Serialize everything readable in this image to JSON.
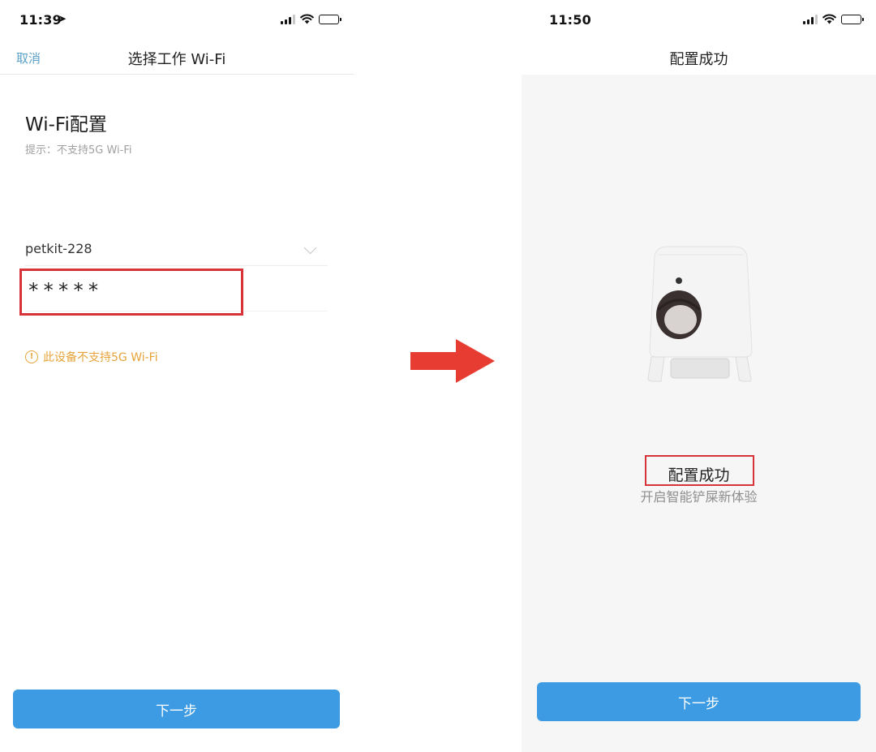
{
  "colors": {
    "accent_blue": "#3d9be3",
    "link_blue": "#5aa0c8",
    "warning_orange": "#e6a33a",
    "highlight_red": "#d9333a",
    "arrow_red": "#e63c32"
  },
  "left_screen": {
    "status": {
      "time": "11:39"
    },
    "nav": {
      "cancel_label": "取消",
      "title": "选择工作 Wi-Fi"
    },
    "section_title": "Wi-Fi配置",
    "hint": "提示：不支持5G Wi-Fi",
    "ssid_value": "petkit-228",
    "password_value": "*****",
    "warning_icon": "info-icon",
    "warning_text": "此设备不支持5G Wi-Fi",
    "next_label": "下一步"
  },
  "right_screen": {
    "status": {
      "time": "11:50"
    },
    "nav": {
      "title": "配置成功"
    },
    "success_title": "配置成功",
    "success_subtitle": "开启智能铲屎新体验",
    "next_label": "下一步"
  }
}
